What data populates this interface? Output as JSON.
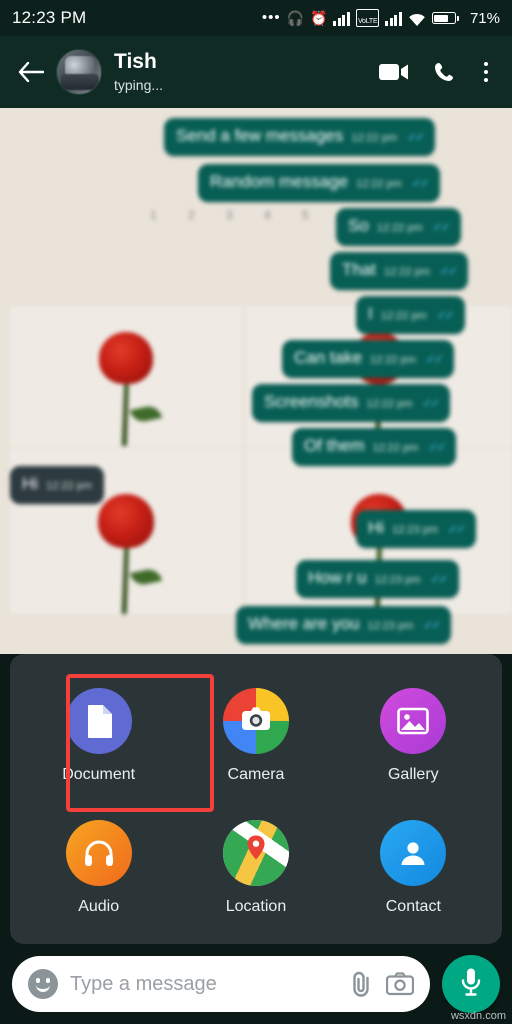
{
  "status_bar": {
    "time": "12:23 PM",
    "dots": "•••",
    "headphone_icon": "headphone-icon",
    "alarm_icon": "alarm-icon",
    "signal_icon": "signal-bars-icon",
    "volte_label": "VoLTE",
    "signal2_icon": "signal-bars-icon",
    "wifi_icon": "wifi-icon",
    "battery_icon": "battery-icon",
    "battery_percent": "71%"
  },
  "app_bar": {
    "back_icon": "back-arrow-icon",
    "avatar": "contact-avatar",
    "contact_name": "Tish",
    "contact_status": "typing...",
    "video_call_icon": "video-call-icon",
    "voice_call_icon": "phone-call-icon",
    "overflow_icon": "more-options-icon"
  },
  "chat": {
    "date_divider": "1 2 3 4 5 6 7",
    "messages": [
      {
        "text": "Send a few messages",
        "time": "12:22 pm",
        "side": "out",
        "ticks": "✓✓"
      },
      {
        "text": "Random message",
        "time": "12:22 pm",
        "side": "out",
        "ticks": "✓✓"
      },
      {
        "text": "So",
        "time": "12:22 pm",
        "side": "out",
        "ticks": "✓✓"
      },
      {
        "text": "That",
        "time": "12:22 pm",
        "side": "out",
        "ticks": "✓✓"
      },
      {
        "text": "I",
        "time": "12:22 pm",
        "side": "out",
        "ticks": "✓✓"
      },
      {
        "text": "Can take",
        "time": "12:22 pm",
        "side": "out",
        "ticks": "✓✓"
      },
      {
        "text": "Screenshots",
        "time": "12:22 pm",
        "side": "out",
        "ticks": "✓✓"
      },
      {
        "text": "Of them",
        "time": "12:22 pm",
        "side": "out",
        "ticks": "✓✓"
      },
      {
        "text": "Hi",
        "time": "12:22 pm",
        "side": "in",
        "ticks": ""
      },
      {
        "text": "Hi",
        "time": "12:23 pm",
        "side": "out",
        "ticks": "✓✓"
      },
      {
        "text": "How r u",
        "time": "12:23 pm",
        "side": "out",
        "ticks": "✓✓"
      },
      {
        "text": "Where are you",
        "time": "12:23 pm",
        "side": "out",
        "ticks": "✓✓"
      }
    ]
  },
  "attachment_sheet": {
    "items": [
      {
        "label": "Document",
        "icon": "document-icon",
        "color": "#5f6ad3",
        "highlighted": true
      },
      {
        "label": "Camera",
        "icon": "camera-icon",
        "color": "#ea4335",
        "highlighted": false
      },
      {
        "label": "Gallery",
        "icon": "gallery-icon",
        "color": "#c13fd6",
        "highlighted": false
      },
      {
        "label": "Audio",
        "icon": "headphones-icon",
        "color": "#f59e0b",
        "highlighted": false
      },
      {
        "label": "Location",
        "icon": "location-pin-icon",
        "color": "#34a853",
        "highlighted": false
      },
      {
        "label": "Contact",
        "icon": "contact-person-icon",
        "color": "#1e9df1",
        "highlighted": false
      }
    ],
    "highlight_color": "#f4403a"
  },
  "composer": {
    "emoji_icon": "emoji-icon",
    "placeholder": "Type a message",
    "value": "",
    "attach_icon": "paperclip-icon",
    "camera_icon": "camera-icon",
    "mic_icon": "microphone-icon",
    "mic_color": "#00a884"
  },
  "watermark": {
    "text": "wsxdn.com"
  }
}
